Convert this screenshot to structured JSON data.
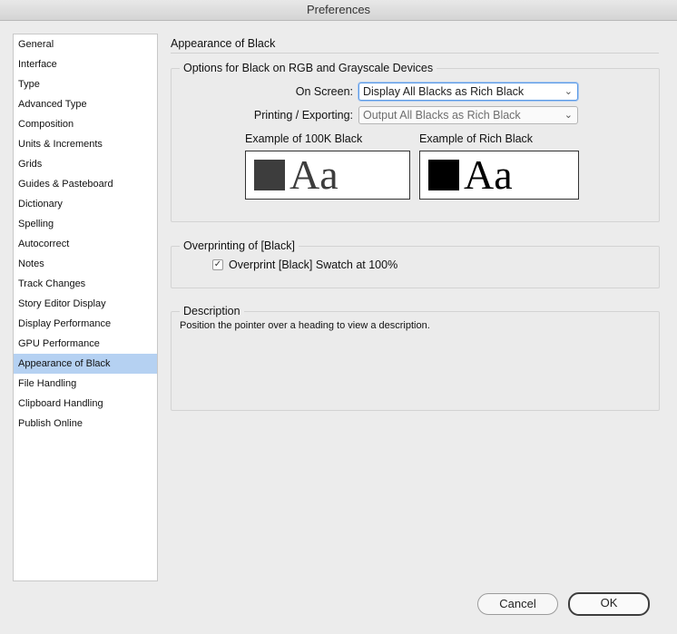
{
  "window": {
    "title": "Preferences"
  },
  "sidebar": {
    "items": [
      {
        "label": "General"
      },
      {
        "label": "Interface"
      },
      {
        "label": "Type"
      },
      {
        "label": "Advanced Type"
      },
      {
        "label": "Composition"
      },
      {
        "label": "Units & Increments"
      },
      {
        "label": "Grids"
      },
      {
        "label": "Guides & Pasteboard"
      },
      {
        "label": "Dictionary"
      },
      {
        "label": "Spelling"
      },
      {
        "label": "Autocorrect"
      },
      {
        "label": "Notes"
      },
      {
        "label": "Track Changes"
      },
      {
        "label": "Story Editor Display"
      },
      {
        "label": "Display Performance"
      },
      {
        "label": "GPU Performance"
      },
      {
        "label": "Appearance of Black"
      },
      {
        "label": "File Handling"
      },
      {
        "label": "Clipboard Handling"
      },
      {
        "label": "Publish Online"
      }
    ],
    "selected": "Appearance of Black"
  },
  "main": {
    "title": "Appearance of Black",
    "options_group": {
      "label": "Options for Black on RGB and Grayscale Devices",
      "on_screen_label": "On Screen:",
      "on_screen_value": "Display All Blacks as Rich Black",
      "printing_label": "Printing / Exporting:",
      "printing_value": "Output All Blacks as Rich Black",
      "example_100k_label": "Example of 100K Black",
      "example_rich_label": "Example of Rich Black",
      "sample_text": "Aa",
      "colors": {
        "black_100k": "#3d3d3d",
        "rich_black": "#000000"
      }
    },
    "overprint_group": {
      "label": "Overprinting of [Black]",
      "checkbox_label": "Overprint [Black] Swatch at 100%",
      "checked": true,
      "check_glyph": "✓"
    },
    "description_group": {
      "label": "Description",
      "text": "Position the pointer over a heading to view a description."
    }
  },
  "footer": {
    "cancel_label": "Cancel",
    "ok_label": "OK"
  },
  "icons": {
    "chevron": "⌄"
  }
}
